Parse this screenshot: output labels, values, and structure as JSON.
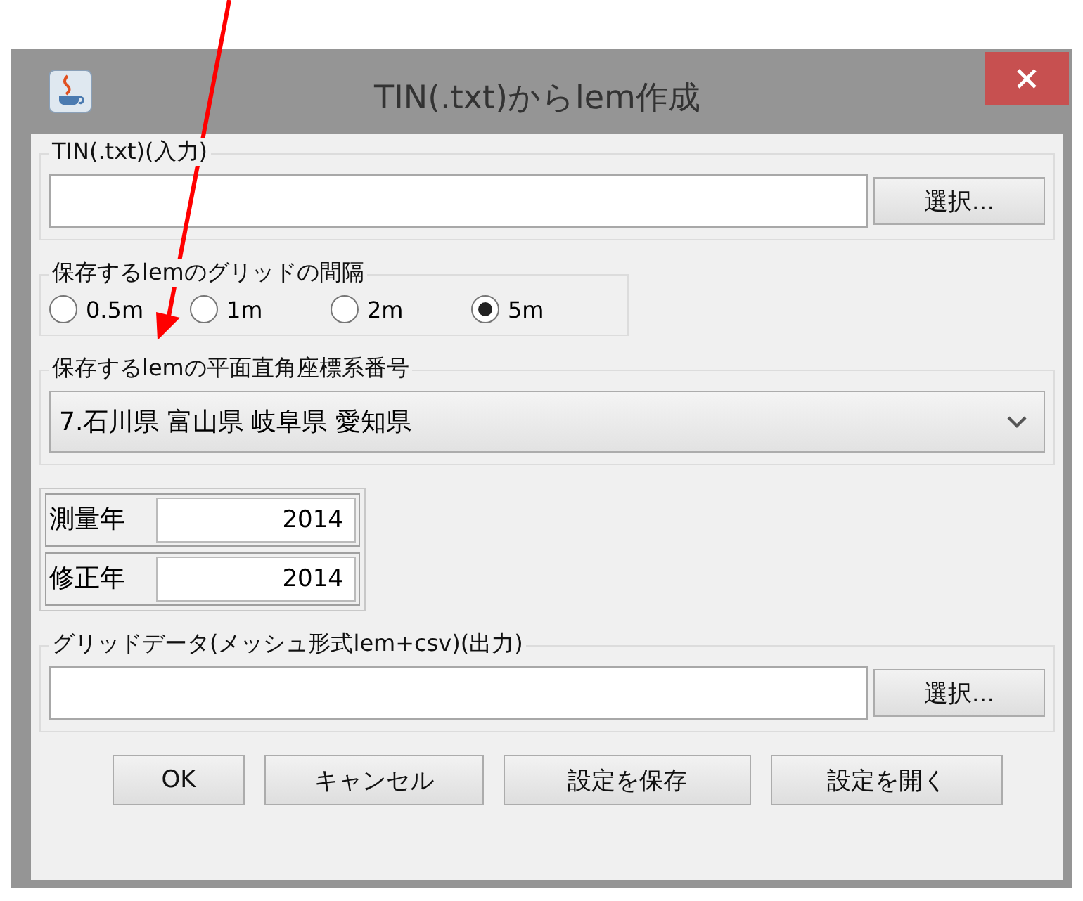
{
  "window": {
    "title": "TIN(.txt)からlem作成"
  },
  "input_group": {
    "legend": "TIN(.txt)(入力)",
    "button": "選択..."
  },
  "grid_spacing": {
    "legend": "保存するlemのグリッドの間隔",
    "options": [
      {
        "label": "0.5m",
        "selected": false
      },
      {
        "label": "1m",
        "selected": false
      },
      {
        "label": "2m",
        "selected": false
      },
      {
        "label": "5m",
        "selected": true
      }
    ]
  },
  "coordinate_system": {
    "legend": "保存するlemの平面直角座標系番号",
    "value": "7.石川県 富山県 岐阜県 愛知県"
  },
  "years": [
    {
      "label": "測量年",
      "value": "2014"
    },
    {
      "label": "修正年",
      "value": "2014"
    }
  ],
  "output_group": {
    "legend": "グリッドデータ(メッシュ形式lem+csv)(出力)",
    "button": "選択..."
  },
  "buttons": [
    "OK",
    "キャンセル",
    "設定を保存",
    "設定を開く"
  ]
}
